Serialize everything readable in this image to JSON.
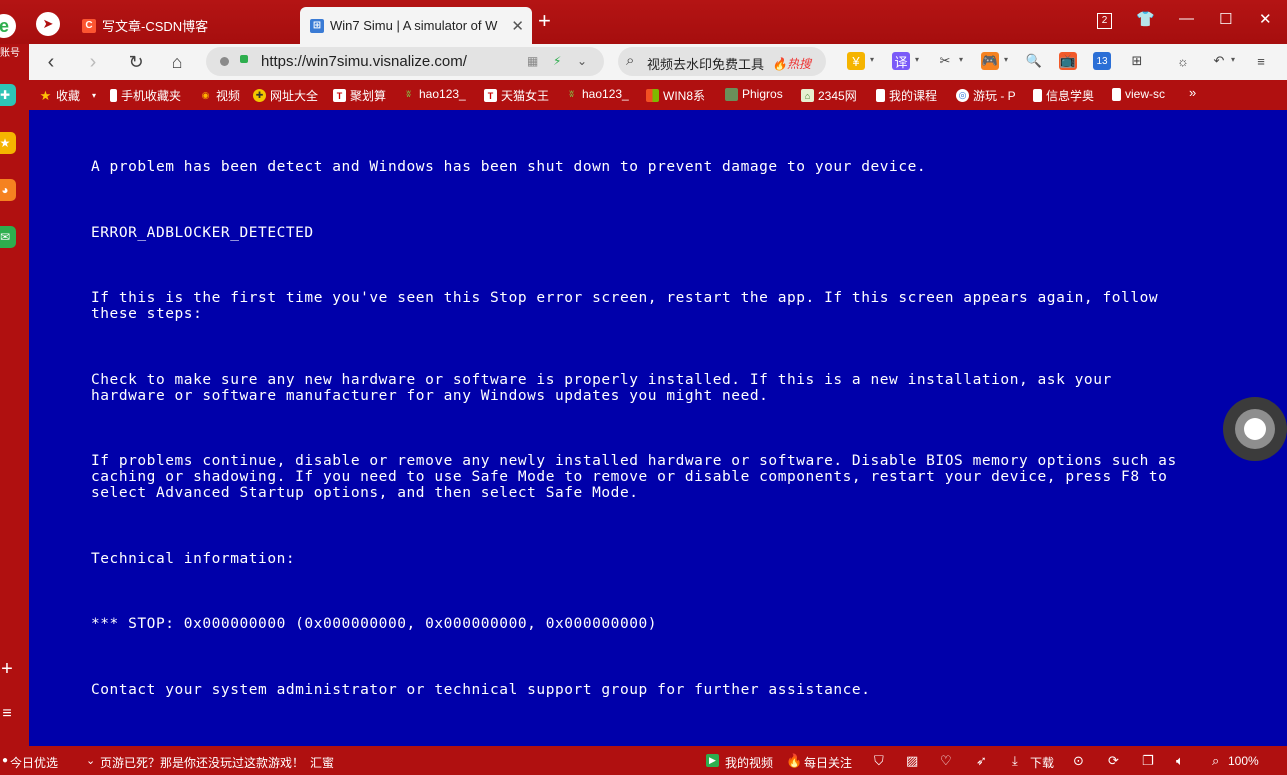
{
  "tabs": [
    {
      "title": "写文章-CSDN博客",
      "icon": "csdn-icon"
    },
    {
      "title": "Win7 Simu | A simulator of W",
      "icon": "windows-icon",
      "active": true
    }
  ],
  "window": {
    "tab_count_badge": "2"
  },
  "nav": {
    "url": "https://win7simu.visnalize.com/",
    "search_text": "视频去水印免费工具",
    "search_hot": "🔥热搜",
    "translate_label": "译",
    "badge_13": "13"
  },
  "bookmarks": [
    {
      "label": "收藏",
      "icon": "star-icon"
    },
    {
      "label": "手机收藏夹",
      "icon": "phone-icon"
    },
    {
      "label": "视频",
      "icon": "video-icon"
    },
    {
      "label": "网址大全",
      "icon": "nav-icon"
    },
    {
      "label": "聚划算",
      "icon": "t-icon"
    },
    {
      "label": "hao123_",
      "icon": "hao-icon"
    },
    {
      "label": "天猫女王",
      "icon": "tmall-icon"
    },
    {
      "label": "hao123_",
      "icon": "hao-icon"
    },
    {
      "label": "WIN8系",
      "icon": "win8-icon"
    },
    {
      "label": "Phigros",
      "icon": "phigros-icon"
    },
    {
      "label": "2345网",
      "icon": "2345-icon"
    },
    {
      "label": "我的课程",
      "icon": "doc-icon"
    },
    {
      "label": "游玩 - P",
      "icon": "game-icon"
    },
    {
      "label": "信息学奥",
      "icon": "doc-icon"
    },
    {
      "label": "view-sc",
      "icon": "doc-icon"
    },
    {
      "label": "»",
      "icon": "more-icon"
    }
  ],
  "sidebar": {
    "account_label": "账号"
  },
  "bsod": {
    "line1": "A problem has been detect and Windows has been shut down to prevent damage to your device.",
    "error_code": "ERROR_ADBLOCKER_DETECTED",
    "first_time": "If this is the first time you've seen this Stop error screen, restart the app. If this screen appears again, follow\nthese steps:",
    "check": "Check to make sure any new hardware or software is properly installed. If this is a new installation, ask your\nhardware or software manufacturer for any Windows updates you might need.",
    "problems": "If problems continue, disable or remove any newly installed hardware or software. Disable BIOS memory options such as\ncaching or shadowing. If you need to use Safe Mode to remove or disable components, restart your device, press F8 to\nselect Advanced Startup options, and then select Safe Mode.",
    "tech_info": "Technical information:",
    "stop": "*** STOP: 0x000000000 (0x000000000, 0x000000000, 0x000000000)",
    "contact": "Contact your system administrator or technical support group for further assistance."
  },
  "status": {
    "today": "今日优选",
    "news": "页游已死？那是你还没玩过这款游戏！",
    "news_source": "汇蜜",
    "my_video": "我的视频",
    "daily": "每日关注",
    "download": "下载",
    "zoom": "100%"
  },
  "colors": {
    "chrome_red": "#b01010",
    "bsod_blue": "#0000aa"
  }
}
